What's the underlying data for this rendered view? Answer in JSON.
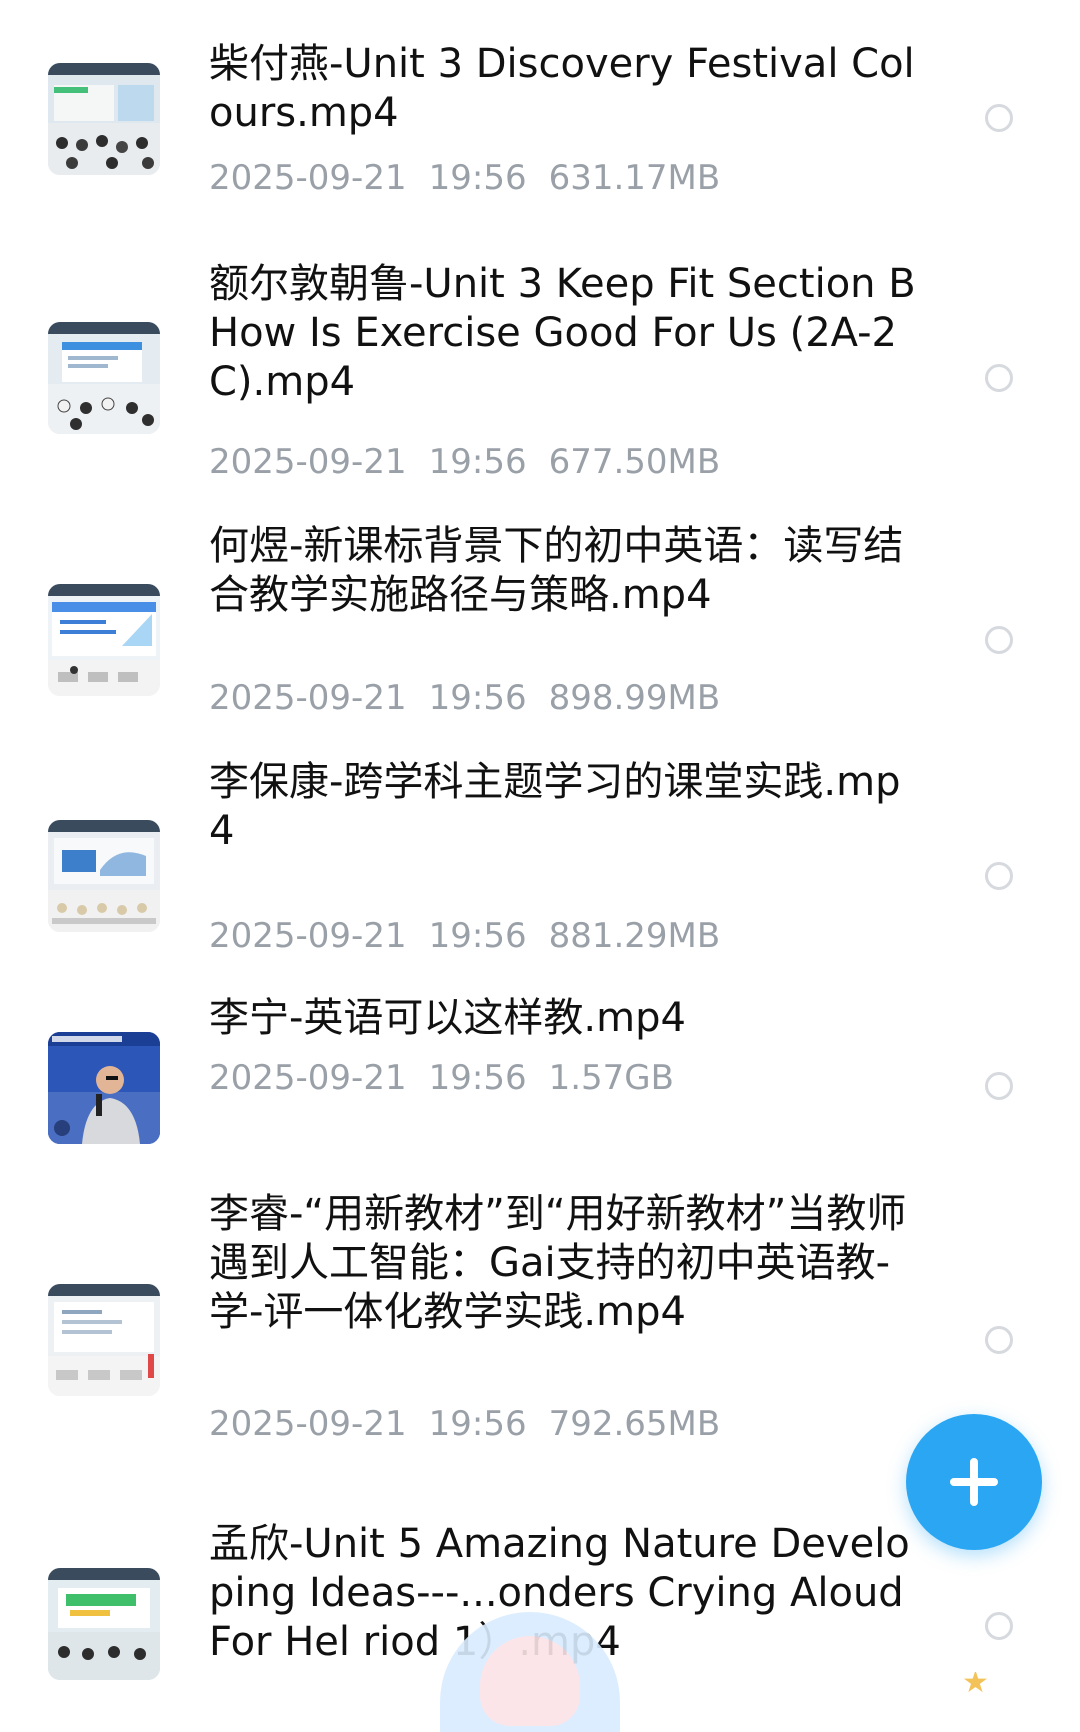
{
  "files": [
    {
      "title": "柴付燕-Unit 3 Discovery Festival Colours.mp4",
      "date": "2025-09-21",
      "time": "19:56",
      "size": "631.17MB",
      "thumbnail": "classroom-lecture-green-screen"
    },
    {
      "title": "额尔敦朝鲁-Unit 3 Keep Fit Section B How Is Exercise Good For Us (2A-2C).mp4",
      "date": "2025-09-21",
      "time": "19:56",
      "size": "677.50MB",
      "thumbnail": "classroom-lecture-blue-screen"
    },
    {
      "title": "何煜-新课标背景下的初中英语：读写结合教学实施路径与策略.mp4",
      "date": "2025-09-21",
      "time": "19:56",
      "size": "898.99MB",
      "thumbnail": "lecture-slide-blue"
    },
    {
      "title": "李保康-跨学科主题学习的课堂实践.mp4",
      "date": "2025-09-21",
      "time": "19:56",
      "size": "881.29MB",
      "thumbnail": "lecture-hall-audience"
    },
    {
      "title": "李宁-英语可以这样教.mp4",
      "date": "2025-09-21",
      "time": "19:56",
      "size": "1.57GB",
      "thumbnail": "speaker-with-microphone"
    },
    {
      "title": "李睿-“用新教材”到“用好新教材”当教师遇到人工智能：Gai支持的初中英语教-学-评一体化教学实践.mp4",
      "date": "2025-09-21",
      "time": "19:56",
      "size": "792.65MB",
      "thumbnail": "lecture-slide-white"
    },
    {
      "title": "孟欣-Unit 5 Amazing Nature Developing Ideas---...onders Crying Aloud For Hel  riod 1）.mp4",
      "date": "",
      "time": "",
      "size": "",
      "thumbnail": "classroom-stage-green"
    }
  ],
  "fab": {
    "icon": "plus-icon"
  },
  "colors": {
    "accent": "#2aa6f3",
    "title": "#111111",
    "meta": "#9aa0a8",
    "radio_border": "#d6d9de"
  }
}
